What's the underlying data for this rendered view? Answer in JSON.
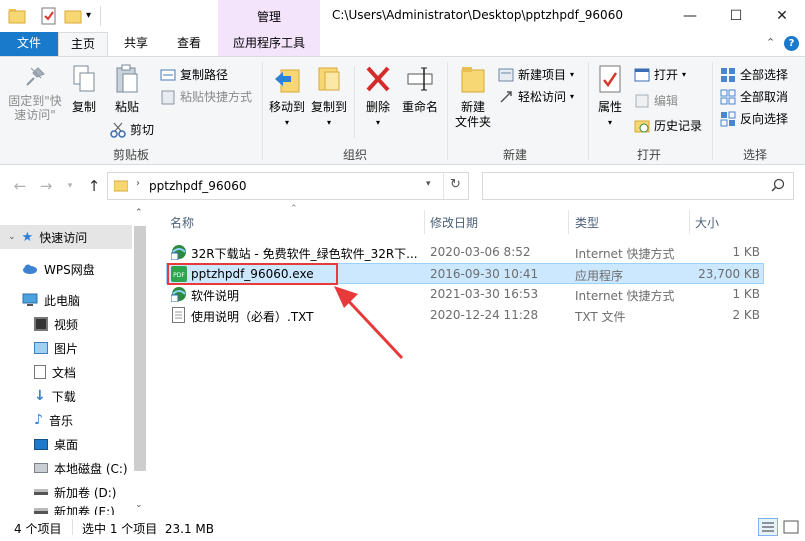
{
  "window": {
    "title_path": "C:\\Users\\Administrator\\Desktop\\pptzhpdf_96060",
    "context_group": "管理",
    "controls": {
      "minimize": "—",
      "maximize": "☐",
      "close": "✕"
    }
  },
  "tabs": {
    "file": "文件",
    "home": "主页",
    "share": "共享",
    "view": "查看",
    "app_tools": "应用程序工具"
  },
  "ribbon": {
    "clipboard": {
      "pin_label": "固定到\"快\n速访问\"",
      "copy": "复制",
      "paste": "粘贴",
      "copy_path": "复制路径",
      "paste_shortcut": "粘贴快捷方式",
      "cut": "剪切",
      "group": "剪贴板"
    },
    "organize": {
      "move_to": "移动到",
      "copy_to": "复制到",
      "delete": "删除",
      "rename": "重命名",
      "group": "组织"
    },
    "new": {
      "new_folder": "新建\n文件夹",
      "new_item": "新建项目",
      "easy_access": "轻松访问",
      "group": "新建"
    },
    "open": {
      "properties": "属性",
      "open": "打开",
      "edit": "编辑",
      "history": "历史记录",
      "group": "打开"
    },
    "select": {
      "select_all": "全部选择",
      "select_none": "全部取消",
      "invert": "反向选择",
      "group": "选择"
    }
  },
  "address": {
    "folder": "pptzhpdf_96060",
    "search_placeholder": ""
  },
  "nav": {
    "quick_access": "快速访问",
    "wps": "WPS网盘",
    "this_pc": "此电脑",
    "video": "视频",
    "pictures": "图片",
    "documents": "文档",
    "downloads": "下载",
    "music": "音乐",
    "desktop": "桌面",
    "local_c": "本地磁盘 (C:)",
    "vol_d": "新加卷 (D:)",
    "vol_e": "新加卷 (E:)"
  },
  "columns": {
    "name": "名称",
    "modified": "修改日期",
    "type": "类型",
    "size": "大小"
  },
  "files": [
    {
      "name": "32R下载站 - 免费软件_绿色软件_32R下...",
      "modified": "2020-03-06 8:52",
      "type": "Internet 快捷方式",
      "size": "1 KB"
    },
    {
      "name": "pptzhpdf_96060.exe",
      "modified": "2016-09-30 10:41",
      "type": "应用程序",
      "size": "23,700 KB"
    },
    {
      "name": "软件说明",
      "modified": "2021-03-30 16:53",
      "type": "Internet 快捷方式",
      "size": "1 KB"
    },
    {
      "name": "使用说明（必看）.TXT",
      "modified": "2020-12-24 11:28",
      "type": "TXT 文件",
      "size": "2 KB"
    }
  ],
  "status": {
    "count": "4 个项目",
    "selected": "选中 1 个项目  23.1 MB"
  },
  "colors": {
    "file_tab": "#1979ca",
    "selection": "#cce8ff",
    "annotation": "#e83a3a",
    "context_tab": "#f3e3fb"
  }
}
